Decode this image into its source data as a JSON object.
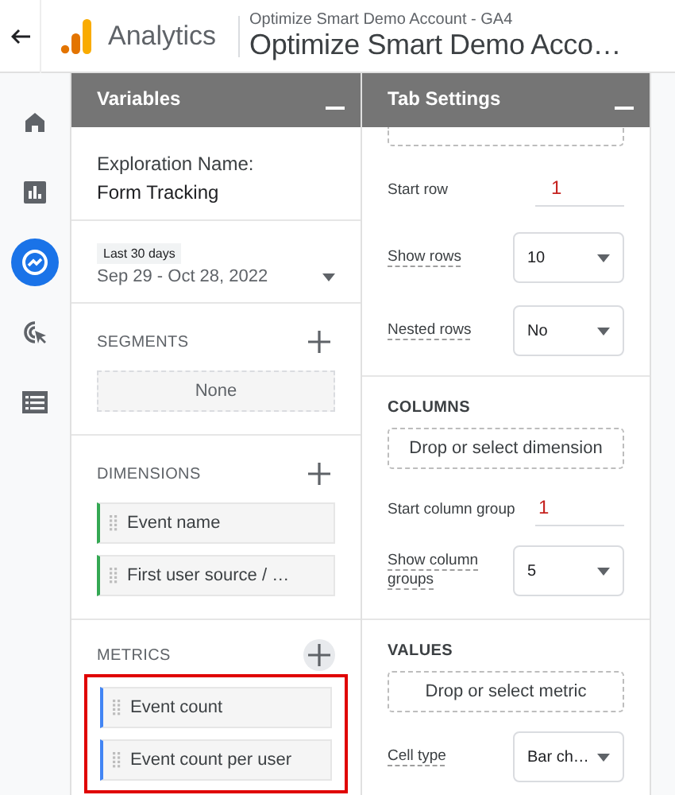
{
  "header": {
    "app_name": "Analytics",
    "account": "Optimize Smart Demo Account - GA4",
    "property": "Optimize Smart Demo Acco…"
  },
  "nav_items": [
    {
      "kind": "home",
      "selected": false
    },
    {
      "kind": "reports",
      "selected": false
    },
    {
      "kind": "explore",
      "selected": true
    },
    {
      "kind": "advertising",
      "selected": false
    },
    {
      "kind": "configure",
      "selected": false
    }
  ],
  "variables": {
    "title": "Variables",
    "exploration_label": "Exploration Name:",
    "exploration_name": "Form Tracking",
    "date_badge": "Last 30 days",
    "date_range": "Sep 29 - Oct 28, 2022",
    "segments": {
      "title": "SEGMENTS",
      "items": [
        "None"
      ]
    },
    "dimensions": {
      "title": "DIMENSIONS",
      "items": [
        "Event name",
        "First user source / …"
      ]
    },
    "metrics": {
      "title": "METRICS",
      "highlighted": true,
      "items": [
        "Event count",
        "Event count per user"
      ]
    }
  },
  "tab_settings": {
    "title": "Tab Settings",
    "rows": {
      "start_label": "Start row",
      "start_value": "1",
      "show_label": "Show rows",
      "show_value": "10",
      "nested_label": "Nested rows",
      "nested_value": "No"
    },
    "columns": {
      "title": "COLUMNS",
      "drop_hint": "Drop or select dimension",
      "start_label": "Start column group",
      "start_value": "1",
      "show_label": "Show column groups",
      "show_value": "5"
    },
    "values": {
      "title": "VALUES",
      "drop_hint": "Drop or select metric",
      "cell_type_label": "Cell type",
      "cell_type_value": "Bar ch…"
    }
  }
}
